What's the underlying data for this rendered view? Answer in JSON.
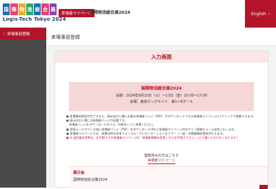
{
  "header": {
    "logo_chars": [
      "国",
      "際",
      "物",
      "流",
      "総",
      "合",
      "展"
    ],
    "logo_tile_colors": [
      "#1f6fb5",
      "#e83f6f",
      "#f7a823",
      "#2aa66c",
      "#1f6fb5",
      "#e83f6f",
      "#8e44ad"
    ],
    "tagline": "Logis-Tech Tokyo 2024",
    "tag": "来場者マイページ",
    "title": "国際物流総合展2024",
    "lang_label": "English",
    "lang_icon": "chevron-right-icon"
  },
  "sidebar": {
    "items": [
      {
        "label": "来場事前登録",
        "icon": "chevron-right-icon"
      }
    ]
  },
  "page": {
    "title": "来場事前登録"
  },
  "form": {
    "section_title": "入力画面",
    "event": {
      "name": "国際物流総合展2024",
      "dates": "会期：2024年9月10日（火）〜13日（金）10:00〜17:00",
      "venue": "会場：東京ビッグサイト　東1〜8ホール"
    },
    "notes": [
      "来場事前登録が完了すると、展示会の入場に必要な来場者バッジ（PDF）がダウンロードできる来場者マイページに1クリックで移動できます。",
      "展示会の入場には来場者バッジが必要です。",
      "来場者バッジをダウンロードのうえ、印刷をしてご来場ください。",
      "登録メールアドレス宛に来場者バッジ（PDF）のダウンロードURLと来場者マイページのログイン情報をメール送信いたします。",
      "来場者マイページでは、来場日時の未来フォーラム／プレゼンテーションセミナー（一部）の聴講事前登録が行えます。"
    ],
    "warning": "※ 送信後の変更は、お手数ですが来場者マイページの「来場者情報の変更」からお手続き下さい。（ご入場いただけなくなります）",
    "registered_question": "登録済みの方はこちら",
    "registered_link": "来場者マイページ",
    "exhibition_label": "展示会",
    "exhibition_value": "国際物流総合展2024"
  }
}
